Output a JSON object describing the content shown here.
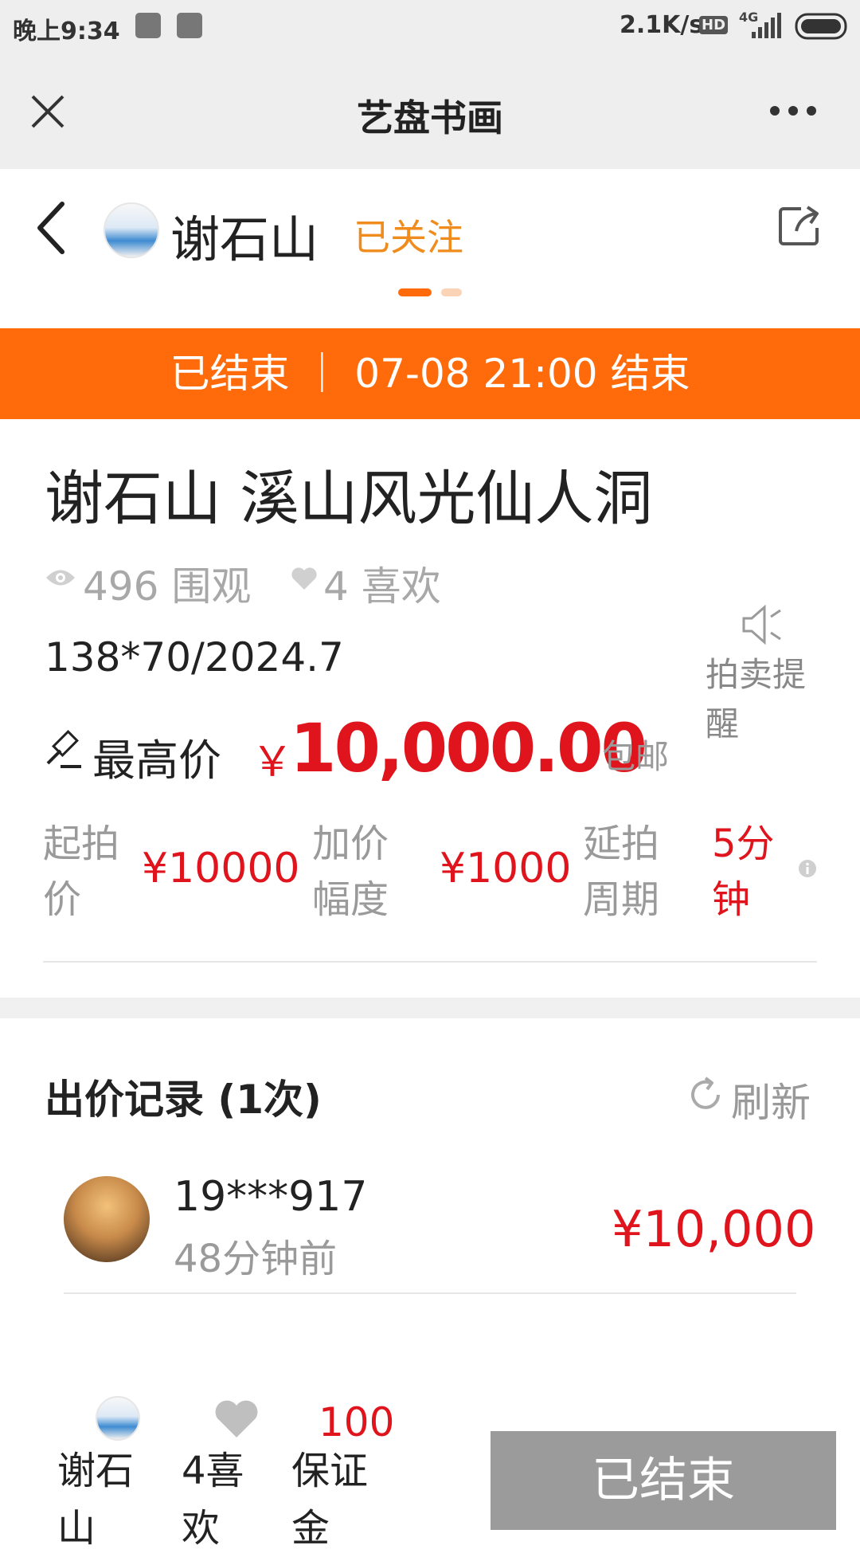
{
  "status_bar": {
    "time": "晚上9:34",
    "speed": "2.1K/s",
    "hd": "HD",
    "network": "4G"
  },
  "title_bar": {
    "title": "艺盘书画"
  },
  "header": {
    "seller_name": "谢石山",
    "follow_status": "已关注"
  },
  "banner": {
    "text": "已结束 ｜ 07-08 21:00  结束"
  },
  "item": {
    "title": "谢石山 溪山风光仙人洞",
    "views": "496 围观",
    "likes": "4 喜欢",
    "specs": "138*70/2024.7",
    "remind_label": "拍卖提醒",
    "price_label": "最高价",
    "currency": "￥",
    "price": "10,000.00",
    "shipping": "包邮",
    "start_label": "起拍价",
    "start_value": "¥10000",
    "increment_label": "加价幅度",
    "increment_value": "¥1000",
    "extend_label": "延拍周期",
    "extend_value": "5分钟"
  },
  "bids": {
    "title": "出价记录 (1次)",
    "refresh_label": "刷新",
    "records": [
      {
        "user": "19***917",
        "time": "48分钟前",
        "amount": "¥10,000"
      }
    ]
  },
  "bottom_bar": {
    "seller_label": "谢石山",
    "like_label": "4喜欢",
    "deposit_amount": "100",
    "deposit_label": "保证金",
    "end_button": "已结束"
  },
  "colors": {
    "accent_orange": "#ff6a0a",
    "price_red": "#e0141c",
    "follow_orange": "#f08c1e",
    "ended_gray": "#9b9b9b"
  },
  "icons": [
    "close-icon",
    "more-icon",
    "back-icon",
    "share-icon",
    "eye-icon",
    "heart-icon",
    "speaker-icon",
    "gavel-icon",
    "info-icon",
    "refresh-icon"
  ]
}
